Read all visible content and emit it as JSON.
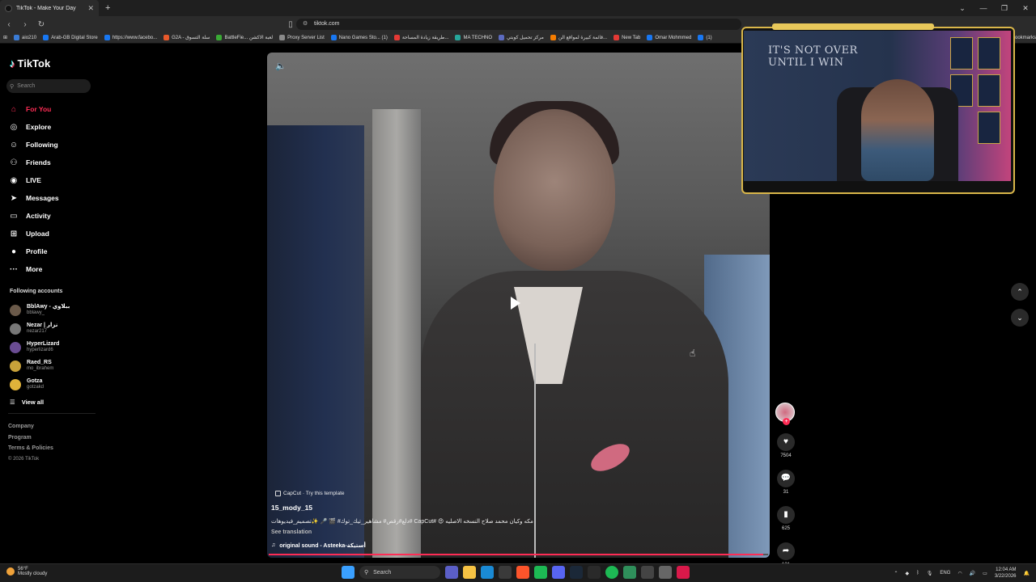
{
  "browser": {
    "tab_title": "TikTok - Make Your Day",
    "url": "tiktok.com",
    "bookmarks": [
      {
        "label": "aio210",
        "color": "#3a7bd5"
      },
      {
        "label": "Arab-GB Digital Store",
        "color": "#1877f2"
      },
      {
        "label": "https://www.facebo...",
        "color": "#1877f2"
      },
      {
        "label": "G2A - سلة التسوق",
        "color": "#e8592b"
      },
      {
        "label": "BattleFie... لعبة الاكشن",
        "color": "#3aaa35"
      },
      {
        "label": "Proxy Server List",
        "color": "#8a8a8a"
      },
      {
        "label": "Nano Games Sto... (1)",
        "color": "#1877f2"
      },
      {
        "label": "طريقة زيادة المساحة...",
        "color": "#e53935"
      },
      {
        "label": "MA TECHNO",
        "color": "#26a69a"
      },
      {
        "label": "مركز تحميل كوبتي",
        "color": "#5c6bc0"
      },
      {
        "label": "قائمة كبيرة لمواقع الن...",
        "color": "#f57c00"
      },
      {
        "label": "New Tab",
        "color": "#e53935"
      },
      {
        "label": "Omar Mohmmed",
        "color": "#1877f2"
      },
      {
        "label": "(1)",
        "color": "#1877f2"
      }
    ],
    "bookmarks_overflow": "ookmarks"
  },
  "sidebar": {
    "brand": "TikTok",
    "search_placeholder": "Search",
    "nav": [
      {
        "label": "For You",
        "icon": "home-icon",
        "glyph": "⌂",
        "active": true
      },
      {
        "label": "Explore",
        "icon": "compass-icon",
        "glyph": "◎"
      },
      {
        "label": "Following",
        "icon": "following-icon",
        "glyph": "☺"
      },
      {
        "label": "Friends",
        "icon": "friends-icon",
        "glyph": "⚇"
      },
      {
        "label": "LIVE",
        "icon": "live-icon",
        "glyph": "◉"
      },
      {
        "label": "Messages",
        "icon": "messages-icon",
        "glyph": "➤"
      },
      {
        "label": "Activity",
        "icon": "activity-icon",
        "glyph": "▭"
      },
      {
        "label": "Upload",
        "icon": "upload-icon",
        "glyph": "⊞"
      },
      {
        "label": "Profile",
        "icon": "profile-icon",
        "glyph": "●"
      },
      {
        "label": "More",
        "icon": "more-icon",
        "glyph": "···"
      }
    ],
    "following_title": "Following accounts",
    "accounts": [
      {
        "name": "BblAwy - ببلاوي",
        "handle": "bblawy_"
      },
      {
        "name": "Nezar | نزار",
        "handle": "nezar217"
      },
      {
        "name": "HyperLizard",
        "handle": "hyperlizard6"
      },
      {
        "name": "Raed_RS",
        "handle": "mo_ibrahem"
      },
      {
        "name": "Gotza",
        "handle": "gotzakd"
      }
    ],
    "view_all": "View all",
    "footer": [
      "Company",
      "Program",
      "Terms & Policies"
    ],
    "copyright": "© 2026 TikTok"
  },
  "video": {
    "template_label": "CapCut · Try this template",
    "author": "15_mody_15",
    "description": "دلع#رقص# مشاهير_تيك_توك# 🎬 🎤 ✨تصميم_فيديوهات# CapCut# 😍 مكه وكيان محمد صلاح النسخه الاصليه",
    "see_translation": "See translation",
    "sound": "original sound - Asteeka-أستيكة",
    "progress": 0.99,
    "likes": "7504",
    "comments": "31",
    "saves": "625",
    "shares": "131"
  },
  "webcam": {
    "overlay_text_line1": "IT'S NOT OVER",
    "overlay_text_line2": "UNTIL I WIN"
  },
  "taskbar": {
    "temp": "56°F",
    "weather": "Mostly cloudy",
    "search": "Search",
    "lang": "ENG",
    "time": "12:04 AM",
    "date": "3/22/2026"
  }
}
